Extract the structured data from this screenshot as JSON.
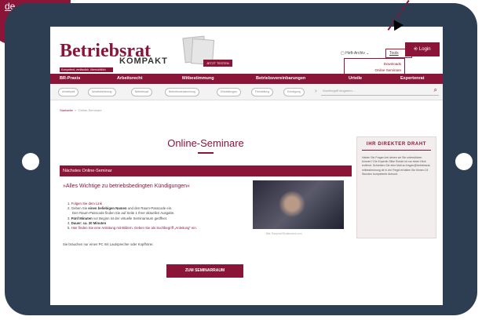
{
  "corner_label": "de",
  "brand": {
    "name": "Betriebsrat",
    "suffix": "KOMPAKT",
    "tagline": "Kompetent, verlässlich, übersichtlich",
    "issue_button": "JETZT TESTEN"
  },
  "utility": {
    "archive": "Heft-Archiv",
    "tools": "Tools",
    "login": "Login"
  },
  "tools_menu": [
    "Downloads",
    "Online Seminare"
  ],
  "nav": [
    "BR-Praxis",
    "Arbeitsrecht",
    "Mitbestimmung",
    "Betriebsvereinbarungen",
    "Urteile",
    "Expertenrat"
  ],
  "topics": [
    "Arbeitszeit",
    "Arbeitsbefreiung",
    "Betriebsrat",
    "Betriebsversammlung",
    "Einstellungen",
    "Freistellung",
    "Kündigung"
  ],
  "search": {
    "placeholder": "Suchbegriff eingeben..."
  },
  "breadcrumb": {
    "home": "Startseite",
    "current": "Online-Seminare"
  },
  "main": {
    "title": "Online-Seminare",
    "next_label": "Nächstes Online-Seminar",
    "seminar_title": "»Alles Wichtige zu betriebsbedingten Kündigungen«",
    "steps": {
      "s1": "Folgen Sie dem Link",
      "s2a": "Geben Sie",
      "s2b": "einen beliebigen Namen",
      "s2c": "und den Raum-Passcode ein.",
      "s2d": "Den Raum-Passcode finden Sie auf Seite 1 Ihrer aktuellen Ausgabe.",
      "s3a": "Fünf Minuten",
      "s3b": "vor Beginn ist der virtuelle Seminarraum geöffnet.",
      "s4": "Dauer: ca. 30 Minuten",
      "s5": "Hier finden Sie eine Anleitung mit Bildern. Geben Sie als Suchbegriff „Anleitung“ ein."
    },
    "note": "Sie brauchen nur einen PC mit Lautsprecher oder Kopfhörer.",
    "photo_credit": "Bild: Rawpixel/Shutterstock.com",
    "cta": "ZUM SEMINARRAUM"
  },
  "aside": {
    "title": "IHR DIREKTER DRAHT",
    "text": "Haben Sie Fragen bei denen wir Sie unterstützen können? Die Expertin Silke Rohde ist nur einen Klick entfernt. Schreiben Sie eine Mail an fragen@betriebsrat-mitbestimmung.de in der Regel erhalten Sie binnen 24 Stunden kompetente Antwort."
  }
}
